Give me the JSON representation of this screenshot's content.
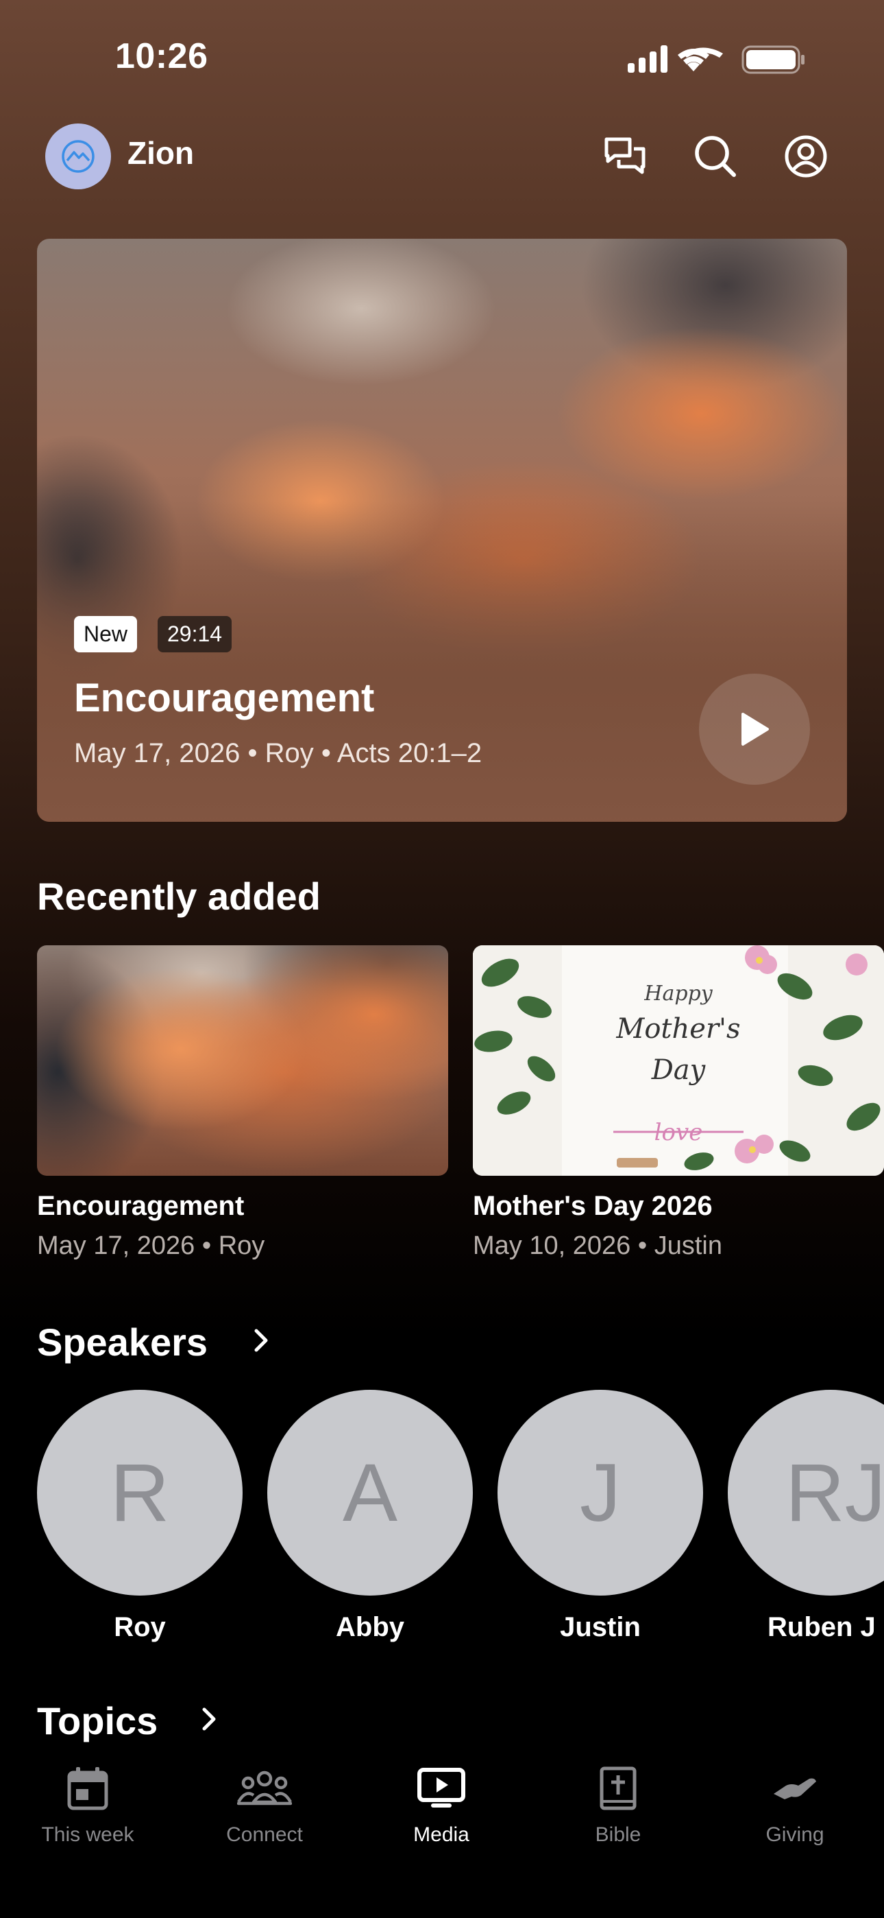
{
  "status_bar": {
    "time": "10:26"
  },
  "header": {
    "app_name": "Zion"
  },
  "hero": {
    "badge": "New",
    "duration": "29:14",
    "title": "Encouragement",
    "date": "May 17, 2026",
    "speaker": "Roy",
    "scripture": "Acts 20:1–2"
  },
  "recently_added": {
    "title": "Recently added",
    "items": [
      {
        "title": "Encouragement",
        "date": "May 17, 2026",
        "speaker": "Roy"
      },
      {
        "title": "Mother's Day 2026",
        "date": "May 10, 2026",
        "speaker": "Justin",
        "card_text": {
          "line1": "Happy",
          "line2": "Mother's",
          "line3": "Day",
          "line4": "love"
        }
      }
    ]
  },
  "speakers": {
    "title": "Speakers",
    "items": [
      {
        "initials": "R",
        "name": "Roy"
      },
      {
        "initials": "A",
        "name": "Abby"
      },
      {
        "initials": "J",
        "name": "Justin"
      },
      {
        "initials": "RJ",
        "name": "Ruben J"
      }
    ]
  },
  "topics": {
    "title": "Topics"
  },
  "tabbar": {
    "items": [
      {
        "label": "This week",
        "icon": "calendar-icon"
      },
      {
        "label": "Connect",
        "icon": "people-icon"
      },
      {
        "label": "Media",
        "icon": "tv-play-icon",
        "active": true
      },
      {
        "label": "Bible",
        "icon": "bible-icon"
      },
      {
        "label": "Giving",
        "icon": "giving-hand-icon"
      }
    ]
  },
  "colors": {
    "background": "#000000",
    "avatar": "#b7bde6",
    "speaker_circle": "#c8c9cd",
    "inactive_tab": "#8a8a8d"
  }
}
